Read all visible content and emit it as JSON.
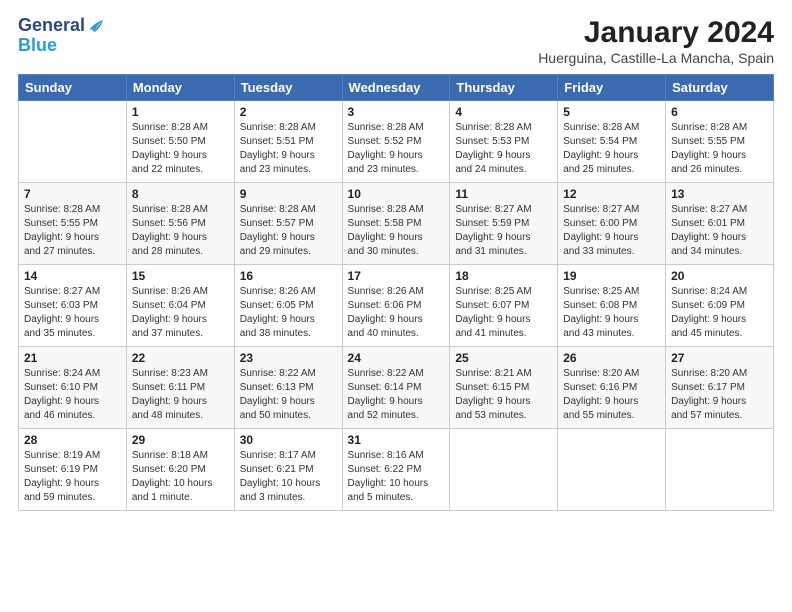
{
  "header": {
    "logo_line1": "General",
    "logo_line2": "Blue",
    "month_title": "January 2024",
    "subtitle": "Huerguina, Castille-La Mancha, Spain"
  },
  "days_of_week": [
    "Sunday",
    "Monday",
    "Tuesday",
    "Wednesday",
    "Thursday",
    "Friday",
    "Saturday"
  ],
  "weeks": [
    [
      {
        "day": "",
        "text": ""
      },
      {
        "day": "1",
        "text": "Sunrise: 8:28 AM\nSunset: 5:50 PM\nDaylight: 9 hours\nand 22 minutes."
      },
      {
        "day": "2",
        "text": "Sunrise: 8:28 AM\nSunset: 5:51 PM\nDaylight: 9 hours\nand 23 minutes."
      },
      {
        "day": "3",
        "text": "Sunrise: 8:28 AM\nSunset: 5:52 PM\nDaylight: 9 hours\nand 23 minutes."
      },
      {
        "day": "4",
        "text": "Sunrise: 8:28 AM\nSunset: 5:53 PM\nDaylight: 9 hours\nand 24 minutes."
      },
      {
        "day": "5",
        "text": "Sunrise: 8:28 AM\nSunset: 5:54 PM\nDaylight: 9 hours\nand 25 minutes."
      },
      {
        "day": "6",
        "text": "Sunrise: 8:28 AM\nSunset: 5:55 PM\nDaylight: 9 hours\nand 26 minutes."
      }
    ],
    [
      {
        "day": "7",
        "text": "Sunrise: 8:28 AM\nSunset: 5:55 PM\nDaylight: 9 hours\nand 27 minutes."
      },
      {
        "day": "8",
        "text": "Sunrise: 8:28 AM\nSunset: 5:56 PM\nDaylight: 9 hours\nand 28 minutes."
      },
      {
        "day": "9",
        "text": "Sunrise: 8:28 AM\nSunset: 5:57 PM\nDaylight: 9 hours\nand 29 minutes."
      },
      {
        "day": "10",
        "text": "Sunrise: 8:28 AM\nSunset: 5:58 PM\nDaylight: 9 hours\nand 30 minutes."
      },
      {
        "day": "11",
        "text": "Sunrise: 8:27 AM\nSunset: 5:59 PM\nDaylight: 9 hours\nand 31 minutes."
      },
      {
        "day": "12",
        "text": "Sunrise: 8:27 AM\nSunset: 6:00 PM\nDaylight: 9 hours\nand 33 minutes."
      },
      {
        "day": "13",
        "text": "Sunrise: 8:27 AM\nSunset: 6:01 PM\nDaylight: 9 hours\nand 34 minutes."
      }
    ],
    [
      {
        "day": "14",
        "text": "Sunrise: 8:27 AM\nSunset: 6:03 PM\nDaylight: 9 hours\nand 35 minutes."
      },
      {
        "day": "15",
        "text": "Sunrise: 8:26 AM\nSunset: 6:04 PM\nDaylight: 9 hours\nand 37 minutes."
      },
      {
        "day": "16",
        "text": "Sunrise: 8:26 AM\nSunset: 6:05 PM\nDaylight: 9 hours\nand 38 minutes."
      },
      {
        "day": "17",
        "text": "Sunrise: 8:26 AM\nSunset: 6:06 PM\nDaylight: 9 hours\nand 40 minutes."
      },
      {
        "day": "18",
        "text": "Sunrise: 8:25 AM\nSunset: 6:07 PM\nDaylight: 9 hours\nand 41 minutes."
      },
      {
        "day": "19",
        "text": "Sunrise: 8:25 AM\nSunset: 6:08 PM\nDaylight: 9 hours\nand 43 minutes."
      },
      {
        "day": "20",
        "text": "Sunrise: 8:24 AM\nSunset: 6:09 PM\nDaylight: 9 hours\nand 45 minutes."
      }
    ],
    [
      {
        "day": "21",
        "text": "Sunrise: 8:24 AM\nSunset: 6:10 PM\nDaylight: 9 hours\nand 46 minutes."
      },
      {
        "day": "22",
        "text": "Sunrise: 8:23 AM\nSunset: 6:11 PM\nDaylight: 9 hours\nand 48 minutes."
      },
      {
        "day": "23",
        "text": "Sunrise: 8:22 AM\nSunset: 6:13 PM\nDaylight: 9 hours\nand 50 minutes."
      },
      {
        "day": "24",
        "text": "Sunrise: 8:22 AM\nSunset: 6:14 PM\nDaylight: 9 hours\nand 52 minutes."
      },
      {
        "day": "25",
        "text": "Sunrise: 8:21 AM\nSunset: 6:15 PM\nDaylight: 9 hours\nand 53 minutes."
      },
      {
        "day": "26",
        "text": "Sunrise: 8:20 AM\nSunset: 6:16 PM\nDaylight: 9 hours\nand 55 minutes."
      },
      {
        "day": "27",
        "text": "Sunrise: 8:20 AM\nSunset: 6:17 PM\nDaylight: 9 hours\nand 57 minutes."
      }
    ],
    [
      {
        "day": "28",
        "text": "Sunrise: 8:19 AM\nSunset: 6:19 PM\nDaylight: 9 hours\nand 59 minutes."
      },
      {
        "day": "29",
        "text": "Sunrise: 8:18 AM\nSunset: 6:20 PM\nDaylight: 10 hours\nand 1 minute."
      },
      {
        "day": "30",
        "text": "Sunrise: 8:17 AM\nSunset: 6:21 PM\nDaylight: 10 hours\nand 3 minutes."
      },
      {
        "day": "31",
        "text": "Sunrise: 8:16 AM\nSunset: 6:22 PM\nDaylight: 10 hours\nand 5 minutes."
      },
      {
        "day": "",
        "text": ""
      },
      {
        "day": "",
        "text": ""
      },
      {
        "day": "",
        "text": ""
      }
    ]
  ]
}
